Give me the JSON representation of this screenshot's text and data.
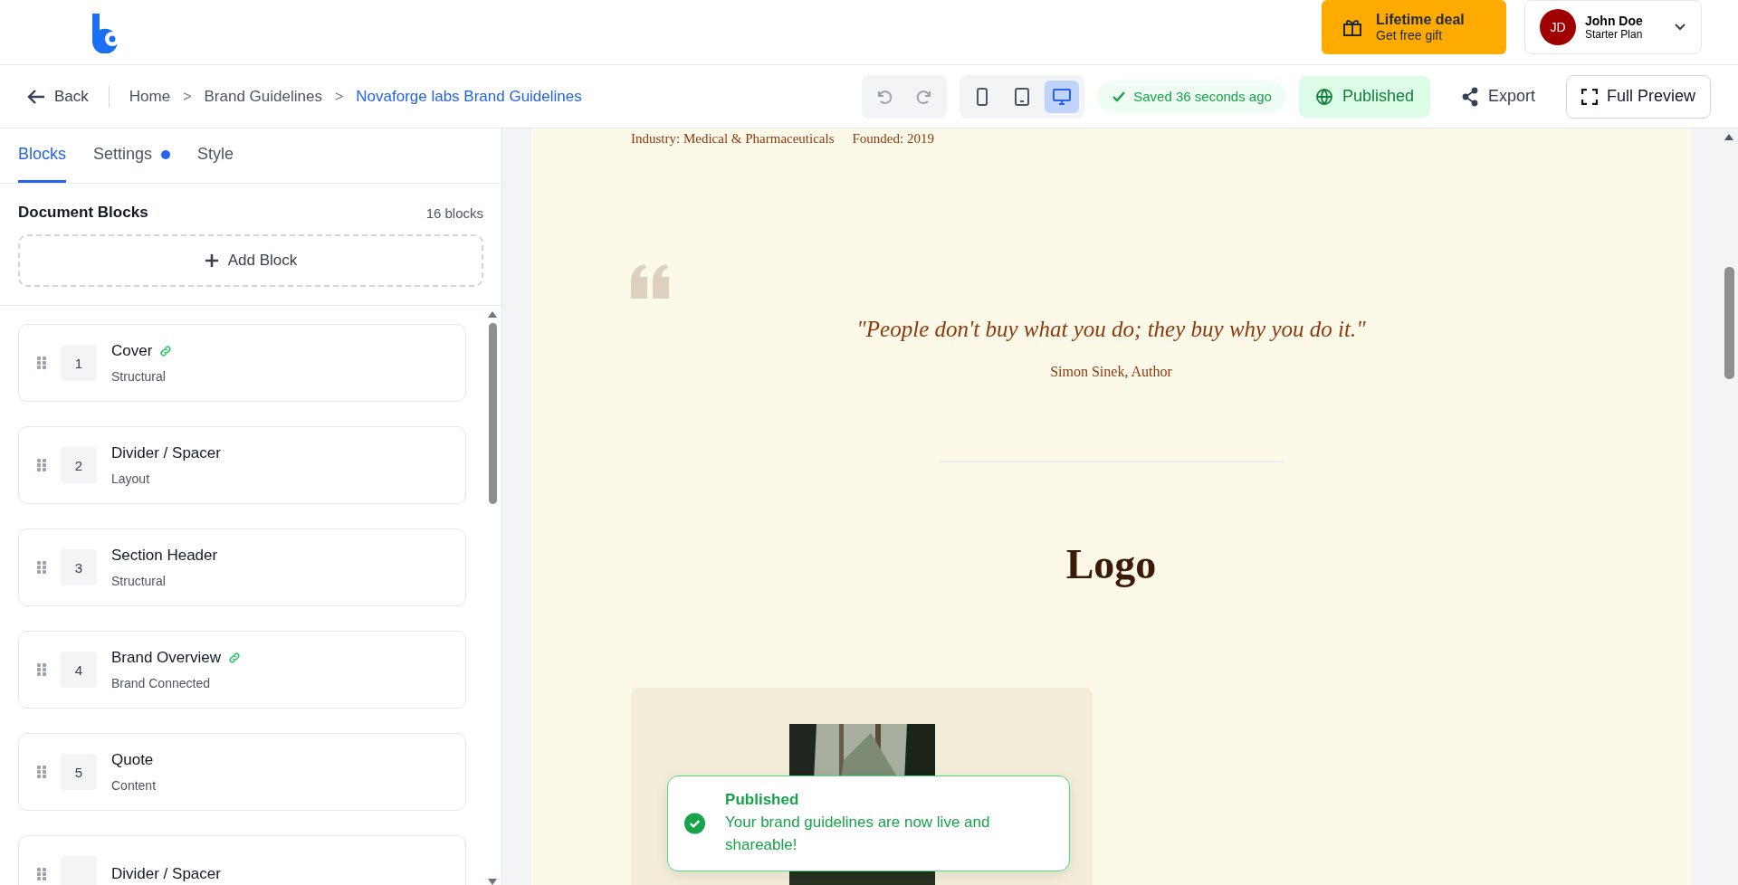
{
  "header": {
    "deal": {
      "title": "Lifetime deal",
      "subtitle": "Get free gift"
    },
    "user": {
      "initials": "JD",
      "name": "John Doe",
      "plan": "Starter Plan"
    }
  },
  "toolbar": {
    "back": "Back",
    "breadcrumbs": [
      {
        "label": "Home",
        "current": false
      },
      {
        "label": "Brand Guidelines",
        "current": false
      },
      {
        "label": "Novaforge labs Brand Guidelines",
        "current": true
      }
    ],
    "separator": ">",
    "devices": [
      {
        "kind": "mobile",
        "selected": false
      },
      {
        "kind": "tablet",
        "selected": false
      },
      {
        "kind": "desktop",
        "selected": true
      }
    ],
    "saved": "Saved 36 seconds ago",
    "published": "Published",
    "export": "Export",
    "full_preview": "Full Preview"
  },
  "sidebar": {
    "tabs": [
      {
        "label": "Blocks",
        "selected": true,
        "badge": false
      },
      {
        "label": "Settings",
        "selected": false,
        "badge": true
      },
      {
        "label": "Style",
        "selected": false,
        "badge": false
      }
    ],
    "title": "Document Blocks",
    "count": "16 blocks",
    "add_button": "Add Block",
    "blocks": [
      {
        "number": "1",
        "title": "Cover",
        "subtitle": "Structural",
        "linked": true
      },
      {
        "number": "2",
        "title": "Divider / Spacer",
        "subtitle": "Layout",
        "linked": false
      },
      {
        "number": "3",
        "title": "Section Header",
        "subtitle": "Structural",
        "linked": false
      },
      {
        "number": "4",
        "title": "Brand Overview",
        "subtitle": "Brand Connected",
        "linked": true
      },
      {
        "number": "5",
        "title": "Quote",
        "subtitle": "Content",
        "linked": false
      },
      {
        "title": "Divider / Spacer",
        "linked": false
      }
    ]
  },
  "preview": {
    "meta": [
      "Industry: Medical & Pharmaceuticals",
      "Founded: 2019"
    ],
    "quote": "\"People don't buy what you do; they buy why you do it.\"",
    "author": "Simon Sinek, Author",
    "heading": "Logo",
    "logo_card": {
      "kind": "picture"
    }
  },
  "toast": {
    "title": "Published",
    "message": "Your brand guidelines are now live and shareable!"
  }
}
